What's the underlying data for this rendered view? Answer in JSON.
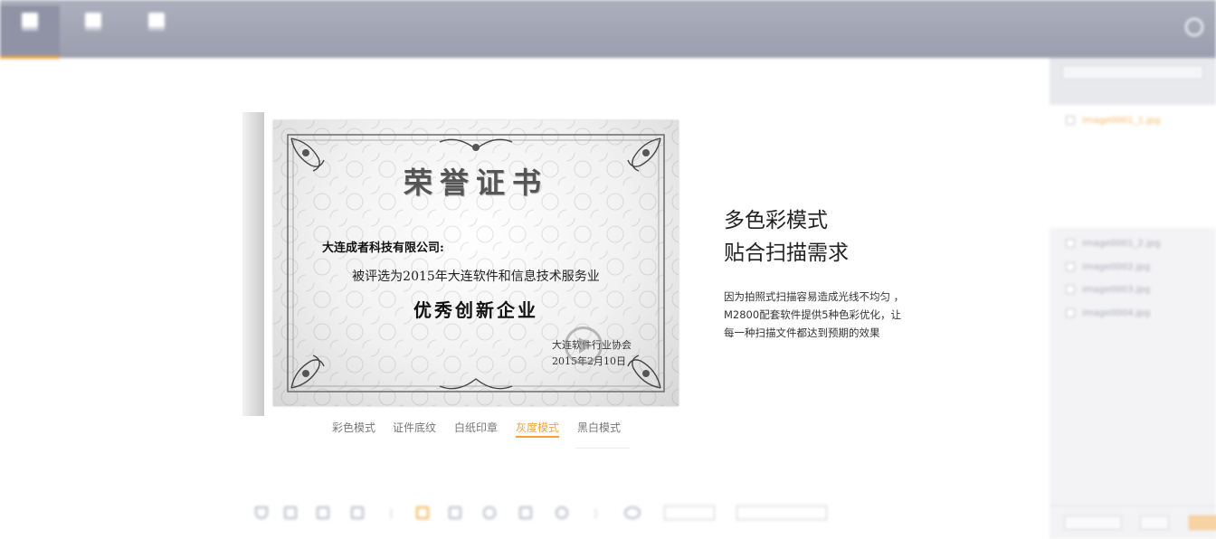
{
  "topbar": {
    "modes": [
      {
        "label": "",
        "active": true
      },
      {
        "label": "",
        "active": false
      },
      {
        "label": "",
        "active": false
      }
    ],
    "nav": [
      "",
      "",
      "",
      "",
      "",
      "",
      "",
      "",
      "",
      "",
      ""
    ],
    "right_label": ""
  },
  "certificate": {
    "title": "荣誉证书",
    "recipient": "大连成者科技有限公司:",
    "line1": "被评选为2015年大连软件和信息技术服务业",
    "award": "优秀创新企业",
    "issuer": "大连软件行业协会",
    "date": "2015年2月10日"
  },
  "mode_tabs": [
    {
      "label": "彩色模式",
      "active": false
    },
    {
      "label": "证件底纹",
      "active": false
    },
    {
      "label": "白纸印章",
      "active": false
    },
    {
      "label": "灰度模式",
      "active": true
    },
    {
      "label": "黑白模式",
      "active": false
    }
  ],
  "feature": {
    "title_line1": "多色彩模式",
    "title_line2": "贴合扫描需求",
    "desc_line1": "因为拍照式扫描容易造成光线不均匀 ，",
    "desc_line2": "M2800配套软件提供5种色彩优化，让",
    "desc_line3": "每一种扫描文件都达到预期的效果"
  },
  "sidebar": {
    "files": [
      {
        "name": "image0001_1.jpg",
        "checked": true
      },
      {
        "name": "image0001_2.jpg",
        "checked": true
      },
      {
        "name": "image0002.jpg",
        "checked": false
      },
      {
        "name": "image0003.jpg",
        "checked": false
      },
      {
        "name": "image0004.jpg",
        "checked": false
      }
    ]
  },
  "colors": {
    "accent": "#f1a43a",
    "topbar": "#a3a6b6",
    "sidebar": "#f3f3f5"
  },
  "icons": [
    "document-icon",
    "play-icon",
    "refresh-icon",
    "checkbox-icon",
    "crop-icon",
    "rotate-icon",
    "eye-icon"
  ]
}
